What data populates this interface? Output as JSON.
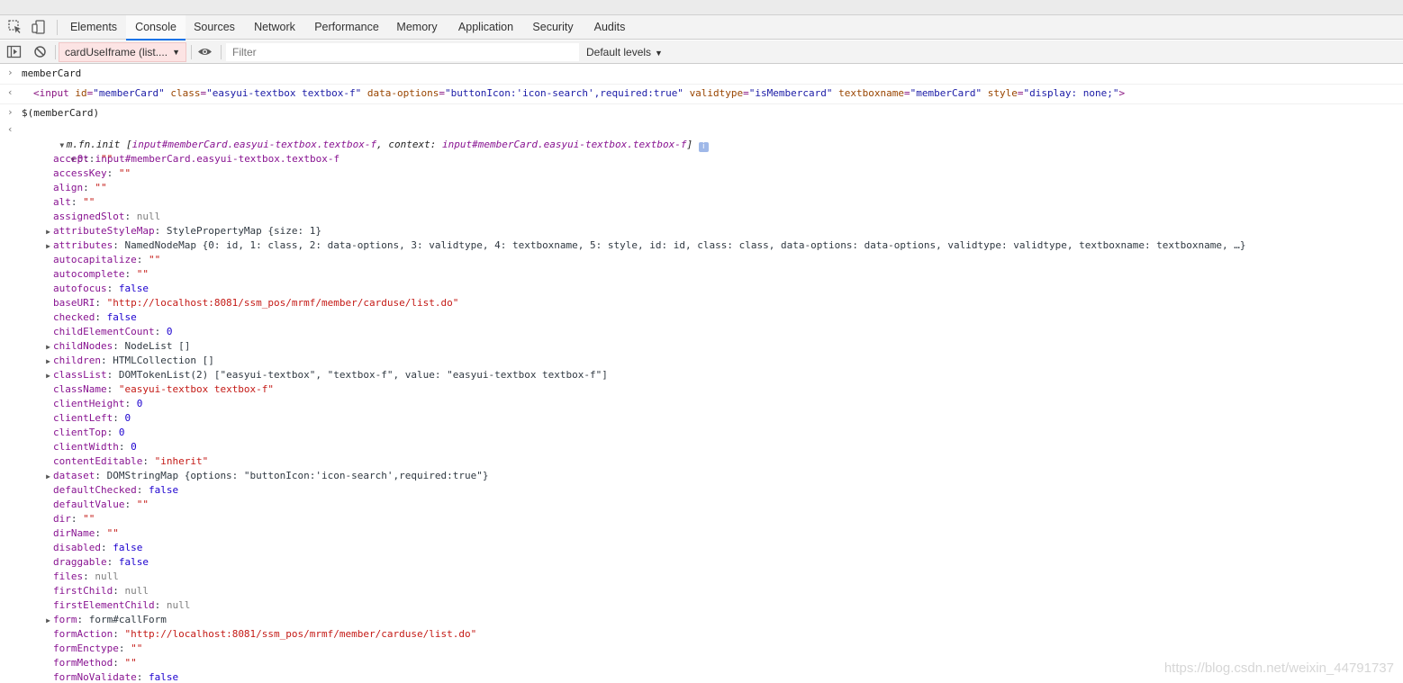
{
  "tabs": [
    "Elements",
    "Console",
    "Sources",
    "Network",
    "Performance",
    "Memory",
    "Application",
    "Security",
    "Audits"
  ],
  "active_tab": "Console",
  "toolbar": {
    "context": "cardUseIframe (list....",
    "filter_placeholder": "Filter",
    "levels": "Default levels"
  },
  "entries": {
    "cmd1": "memberCard",
    "out1": {
      "tag_open": "<input",
      "attrs": [
        {
          "name": "id",
          "value": "\"memberCard\""
        },
        {
          "name": "class",
          "value": "\"easyui-textbox textbox-f\""
        },
        {
          "name": "data-options",
          "value": "\"buttonIcon:'icon-search',required:true\""
        },
        {
          "name": "validtype",
          "value": "\"isMembercard\""
        },
        {
          "name": "textboxname",
          "value": "\"memberCard\""
        },
        {
          "name": "style",
          "value": "\"display: none;\""
        }
      ],
      "tag_close": ">"
    },
    "cmd2": "$(memberCard)",
    "out2_head": {
      "prefix": "m.fn.init [",
      "a": "input#memberCard.easyui-textbox.textbox-f",
      "b": ", context: ",
      "c": "input#memberCard.easyui-textbox.textbox-f",
      "d": "]"
    },
    "item0": {
      "key": "0",
      "value": "input#memberCard.easyui-textbox.textbox-f"
    },
    "props": [
      {
        "key": "accept",
        "value": "\"\"",
        "type": "s",
        "exp": false
      },
      {
        "key": "accessKey",
        "value": "\"\"",
        "type": "s",
        "exp": false
      },
      {
        "key": "align",
        "value": "\"\"",
        "type": "s",
        "exp": false
      },
      {
        "key": "alt",
        "value": "\"\"",
        "type": "s",
        "exp": false
      },
      {
        "key": "assignedSlot",
        "value": "null",
        "type": "nul",
        "exp": false
      },
      {
        "key": "attributeStyleMap",
        "value": "StylePropertyMap {size: 1}",
        "type": "g",
        "exp": true
      },
      {
        "key": "attributes",
        "value": "NamedNodeMap {0: id, 1: class, 2: data-options, 3: validtype, 4: textboxname, 5: style, id: id, class: class, data-options: data-options, validtype: validtype, textboxname: textboxname, …}",
        "type": "g",
        "exp": true
      },
      {
        "key": "autocapitalize",
        "value": "\"\"",
        "type": "s",
        "exp": false
      },
      {
        "key": "autocomplete",
        "value": "\"\"",
        "type": "s",
        "exp": false
      },
      {
        "key": "autofocus",
        "value": "false",
        "type": "n",
        "exp": false
      },
      {
        "key": "baseURI",
        "value": "\"http://localhost:8081/ssm_pos/mrmf/member/carduse/list.do\"",
        "type": "s",
        "exp": false
      },
      {
        "key": "checked",
        "value": "false",
        "type": "n",
        "exp": false
      },
      {
        "key": "childElementCount",
        "value": "0",
        "type": "n",
        "exp": false
      },
      {
        "key": "childNodes",
        "value": "NodeList []",
        "type": "g",
        "exp": true
      },
      {
        "key": "children",
        "value": "HTMLCollection []",
        "type": "g",
        "exp": true
      },
      {
        "key": "classList",
        "value": "DOMTokenList(2) [\"easyui-textbox\", \"textbox-f\", value: \"easyui-textbox textbox-f\"]",
        "type": "g",
        "exp": true
      },
      {
        "key": "className",
        "value": "\"easyui-textbox textbox-f\"",
        "type": "s",
        "exp": false
      },
      {
        "key": "clientHeight",
        "value": "0",
        "type": "n",
        "exp": false
      },
      {
        "key": "clientLeft",
        "value": "0",
        "type": "n",
        "exp": false
      },
      {
        "key": "clientTop",
        "value": "0",
        "type": "n",
        "exp": false
      },
      {
        "key": "clientWidth",
        "value": "0",
        "type": "n",
        "exp": false
      },
      {
        "key": "contentEditable",
        "value": "\"inherit\"",
        "type": "s",
        "exp": false
      },
      {
        "key": "dataset",
        "value": "DOMStringMap {options: \"buttonIcon:'icon-search',required:true\"}",
        "type": "g",
        "exp": true
      },
      {
        "key": "defaultChecked",
        "value": "false",
        "type": "n",
        "exp": false
      },
      {
        "key": "defaultValue",
        "value": "\"\"",
        "type": "s",
        "exp": false
      },
      {
        "key": "dir",
        "value": "\"\"",
        "type": "s",
        "exp": false
      },
      {
        "key": "dirName",
        "value": "\"\"",
        "type": "s",
        "exp": false
      },
      {
        "key": "disabled",
        "value": "false",
        "type": "n",
        "exp": false
      },
      {
        "key": "draggable",
        "value": "false",
        "type": "n",
        "exp": false
      },
      {
        "key": "files",
        "value": "null",
        "type": "nul",
        "exp": false
      },
      {
        "key": "firstChild",
        "value": "null",
        "type": "nul",
        "exp": false
      },
      {
        "key": "firstElementChild",
        "value": "null",
        "type": "nul",
        "exp": false
      },
      {
        "key": "form",
        "value": "form#callForm",
        "type": "g",
        "exp": true
      },
      {
        "key": "formAction",
        "value": "\"http://localhost:8081/ssm_pos/mrmf/member/carduse/list.do\"",
        "type": "s",
        "exp": false
      },
      {
        "key": "formEnctype",
        "value": "\"\"",
        "type": "s",
        "exp": false
      },
      {
        "key": "formMethod",
        "value": "\"\"",
        "type": "s",
        "exp": false
      },
      {
        "key": "formNoValidate",
        "value": "false",
        "type": "n",
        "exp": false
      }
    ]
  },
  "watermark": "https://blog.csdn.net/weixin_44791737"
}
